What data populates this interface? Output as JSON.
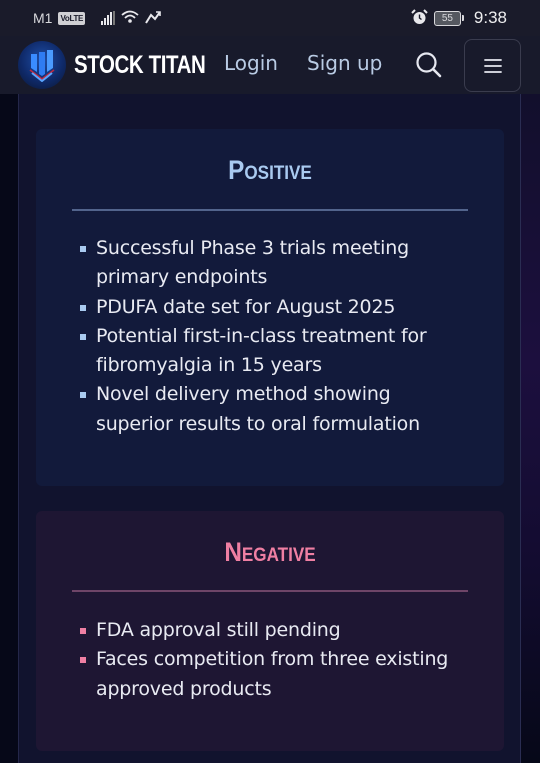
{
  "status_bar": {
    "carrier": "M1",
    "network_badge": "VoLTE",
    "battery_level": "55",
    "time": "9:38",
    "icons": [
      "signal-icon",
      "wifi-icon",
      "sync-icon",
      "alarm-icon",
      "battery-icon"
    ]
  },
  "navbar": {
    "brand": "STOCK TITAN",
    "login_label": "Login",
    "signup_label": "Sign up",
    "search_icon": "search-icon",
    "menu_icon": "hamburger-menu-icon"
  },
  "positive": {
    "title": "Positive",
    "accent_color": "#a9caf0",
    "items": [
      "Successful Phase 3 trials meeting primary endpoints",
      "PDUFA date set for August 2025",
      "Potential first-in-class treatment for fibromyalgia in 15 years",
      "Novel delivery method showing superior results to oral formulation"
    ]
  },
  "negative": {
    "title": "Negative",
    "accent_color": "#ef7fa3",
    "items": [
      "FDA approval still pending",
      "Faces competition from three existing approved products"
    ]
  }
}
